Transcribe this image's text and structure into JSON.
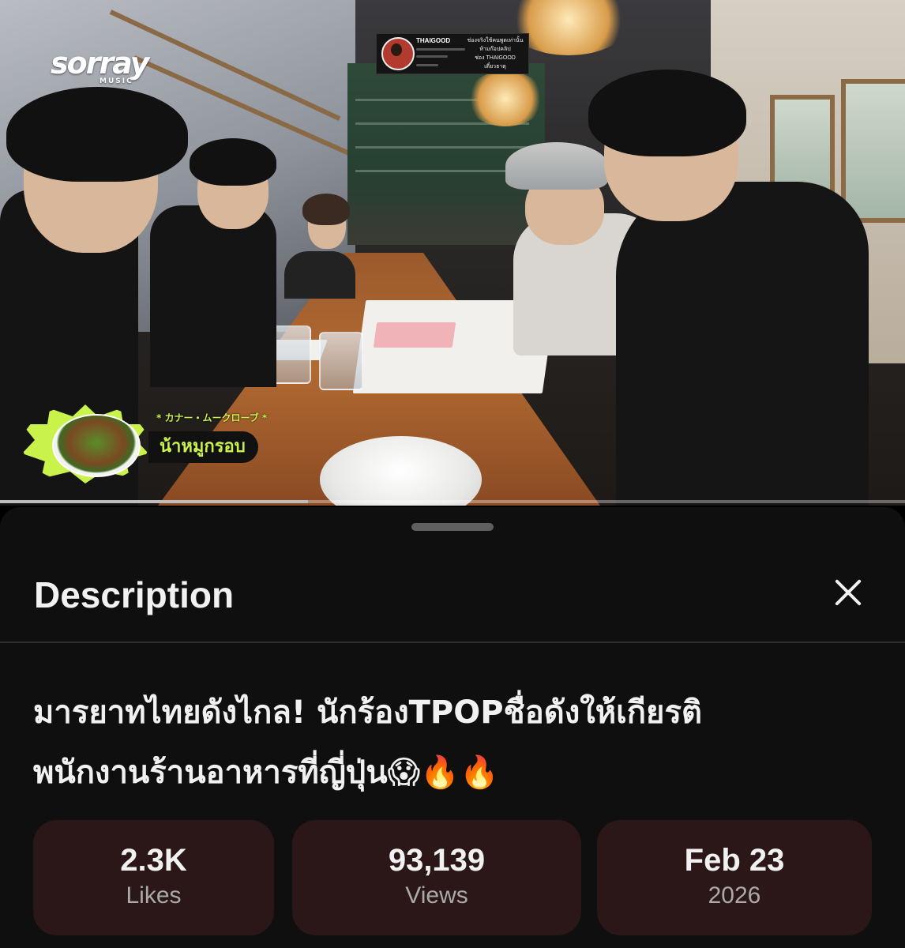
{
  "video": {
    "channel_logo": "sorray",
    "channel_logo_sub": "MUSIC",
    "overlay_channel": {
      "name": "THAIGOOD",
      "text_lines": [
        "ช่องจริงใช้คนพูดเท่านั้น",
        "ห้ามก๊อปคลิป",
        "ช่อง THAIGOOD",
        "เดี๋ยวธาตุ"
      ]
    },
    "food_badge": {
      "jp_tag": "* カナー・ムークローブ *",
      "name": "น้าหมูกรอบ"
    },
    "progress_fraction": 0.34
  },
  "sheet": {
    "title": "Description",
    "close_icon": "close-icon",
    "video_title_line1": "มารยาทไทยดังไกล! นักร้องTPOPชื่อดังให้เกียรติ",
    "video_title_line2": "พนักงานร้านอาหารที่ญี่ปุ่น😱🔥🔥",
    "stats": [
      {
        "value": "2.3K",
        "label": "Likes"
      },
      {
        "value": "93,139",
        "label": "Views"
      },
      {
        "value": "Feb 23",
        "label": "2026"
      }
    ]
  },
  "colors": {
    "sheet_bg": "#0f0f0f",
    "stat_card_bg": "#2b1718",
    "badge_green": "#c9f24a"
  }
}
